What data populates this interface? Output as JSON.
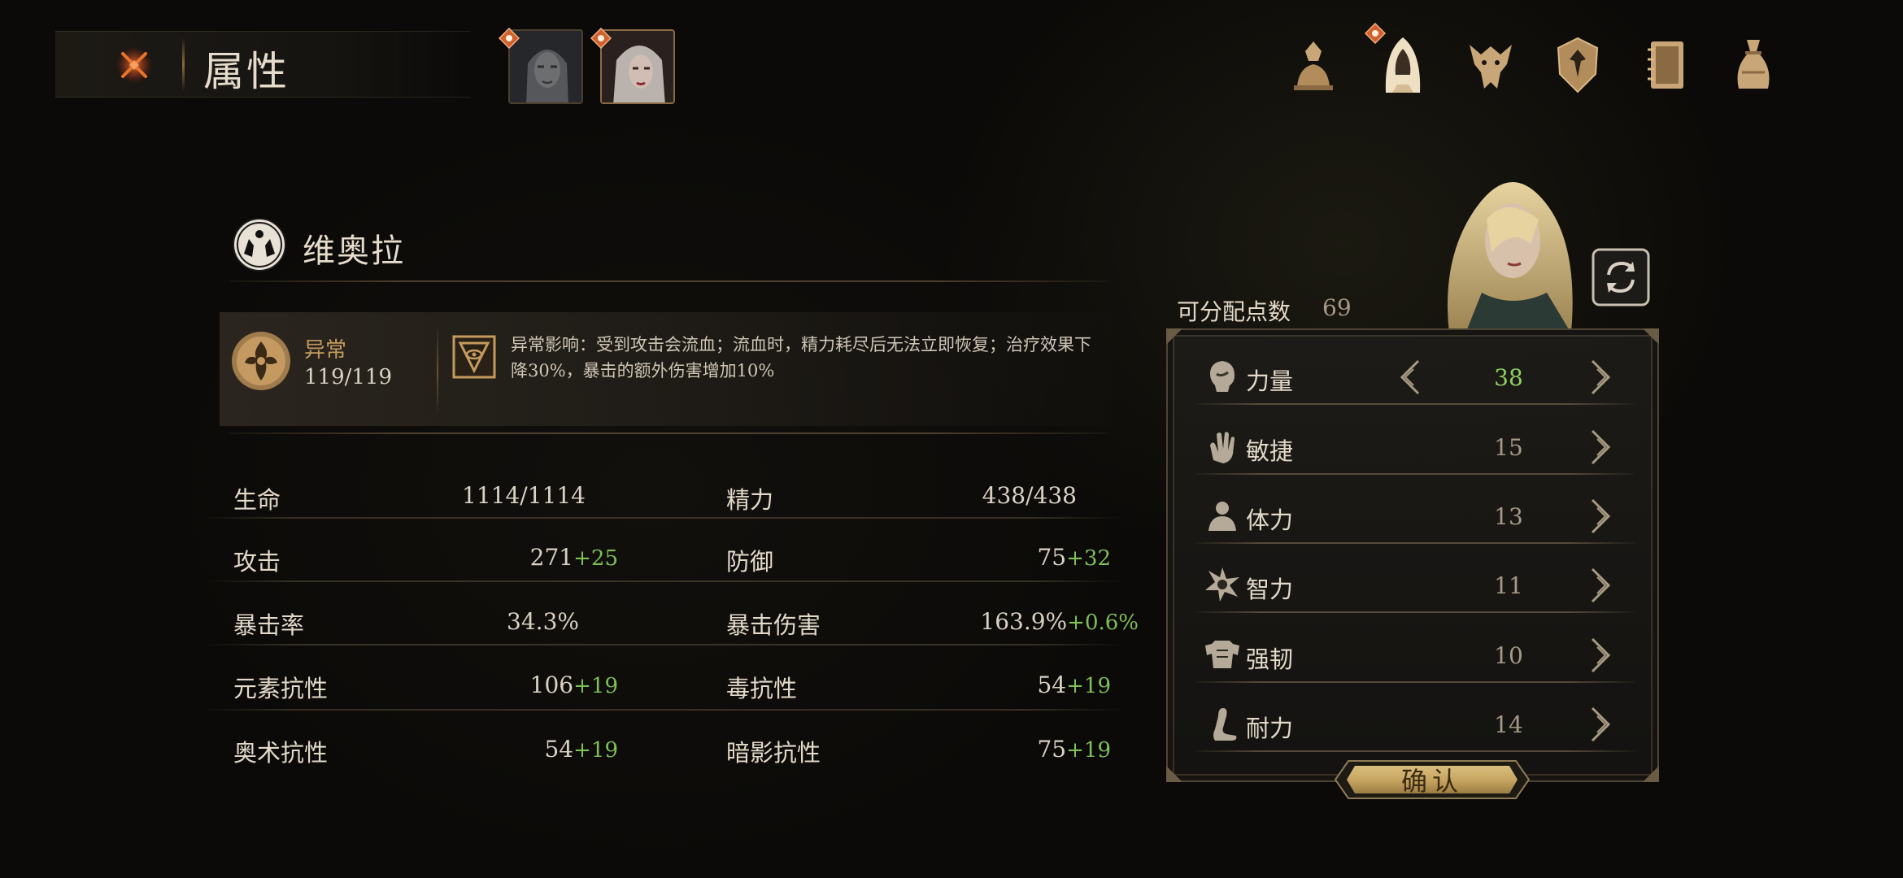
{
  "header": {
    "title": "属性",
    "close_icon": "close-icon"
  },
  "party": [
    {
      "name": "portrait-1",
      "icon": "alert-badge-icon"
    },
    {
      "name": "portrait-2",
      "icon": "alert-badge-icon",
      "selected": true
    }
  ],
  "tabs": [
    {
      "icon": "character-bust-icon"
    },
    {
      "icon": "hooded-figure-icon",
      "active": true,
      "badge": true
    },
    {
      "icon": "beast-skull-icon"
    },
    {
      "icon": "crest-shield-icon"
    },
    {
      "icon": "journal-book-icon"
    },
    {
      "icon": "loot-bag-icon"
    }
  ],
  "character": {
    "name": "维奥拉",
    "emblem_icon": "twin-beasts-emblem-icon"
  },
  "anomaly": {
    "label": "异常",
    "value": "119/119",
    "effect_text": "异常影响：受到攻击会流血；流血时，精力耗尽后无法立即恢复；治疗效果下降30%，暴击的额外伤害增加10%"
  },
  "stats": [
    {
      "left_label": "生命",
      "left_value": "1114/1114",
      "left_bonus": "",
      "right_label": "精力",
      "right_value": "438/438",
      "right_bonus": ""
    },
    {
      "left_label": "攻击",
      "left_value": "271",
      "left_bonus": "+25",
      "right_label": "防御",
      "right_value": "75",
      "right_bonus": "+32"
    },
    {
      "left_label": "暴击率",
      "left_value": "34.3%",
      "left_bonus": "",
      "right_label": "暴击伤害",
      "right_value": "163.9%",
      "right_bonus": "+0.6%"
    },
    {
      "left_label": "元素抗性",
      "left_value": "106",
      "left_bonus": "+19",
      "right_label": "毒抗性",
      "right_value": "54",
      "right_bonus": "+19"
    },
    {
      "left_label": "奥术抗性",
      "left_value": "54",
      "left_bonus": "+19",
      "right_label": "暗影抗性",
      "right_value": "75",
      "right_bonus": "+19"
    }
  ],
  "allocation": {
    "points_label": "可分配点数",
    "points_value": "69",
    "attributes": [
      {
        "label": "力量",
        "value": "38",
        "changed": true,
        "icon": "strength-head-icon"
      },
      {
        "label": "敏捷",
        "value": "15",
        "changed": false,
        "icon": "agility-hand-icon"
      },
      {
        "label": "体力",
        "value": "13",
        "changed": false,
        "icon": "vitality-person-icon"
      },
      {
        "label": "智力",
        "value": "11",
        "changed": false,
        "icon": "intellect-star-icon"
      },
      {
        "label": "强韧",
        "value": "10",
        "changed": false,
        "icon": "toughness-armor-icon"
      },
      {
        "label": "耐力",
        "value": "14",
        "changed": false,
        "icon": "endurance-leg-icon"
      }
    ],
    "confirm_label": "确认"
  },
  "colors": {
    "accent_gold": "#c49a5e",
    "bonus_green": "#7fbf58",
    "changed_green": "#8ccf63",
    "text_main": "#e2d9c9",
    "text_dim": "#a59a86"
  }
}
